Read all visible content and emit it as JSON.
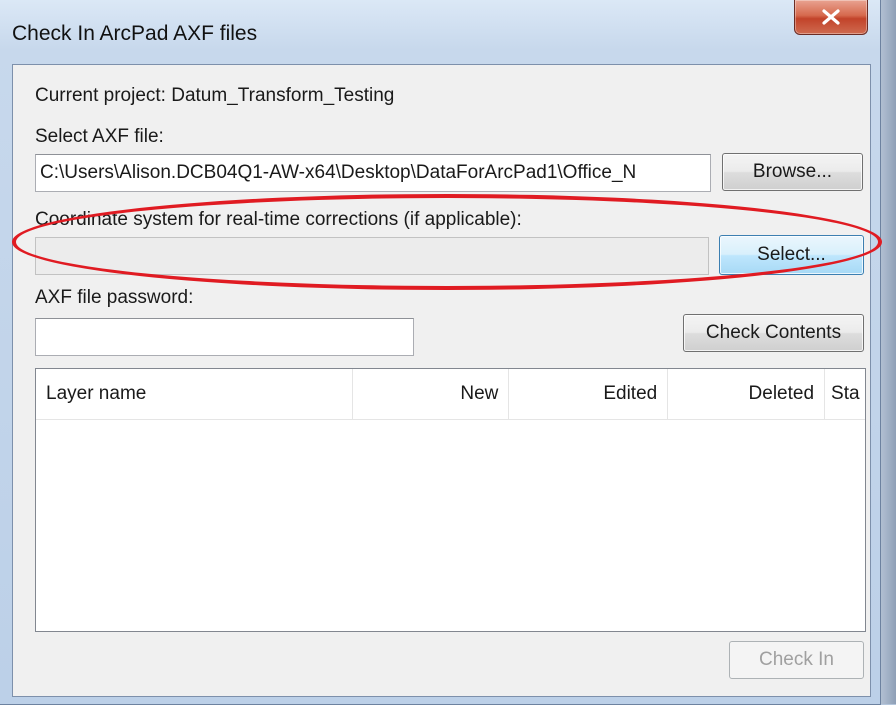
{
  "window": {
    "title": "Check In ArcPad AXF files"
  },
  "form": {
    "current_project_label": "Current project: Datum_Transform_Testing",
    "select_axf_label": "Select AXF file:",
    "axf_path_value": "C:\\Users\\Alison.DCB04Q1-AW-x64\\Desktop\\DataForArcPad1\\Office_N",
    "browse_button": "Browse...",
    "coord_system_label": "Coordinate system for real-time corrections (if applicable):",
    "coord_system_value": "",
    "select_button": "Select...",
    "password_label": "AXF file password:",
    "password_value": "",
    "check_contents_button": "Check Contents",
    "check_in_button": "Check In"
  },
  "layers_table": {
    "columns": [
      "Layer name",
      "New",
      "Edited",
      "Deleted",
      "Sta"
    ],
    "rows": []
  },
  "annotation": {
    "color": "#e01b22"
  },
  "icons": {
    "close": "close-icon"
  }
}
